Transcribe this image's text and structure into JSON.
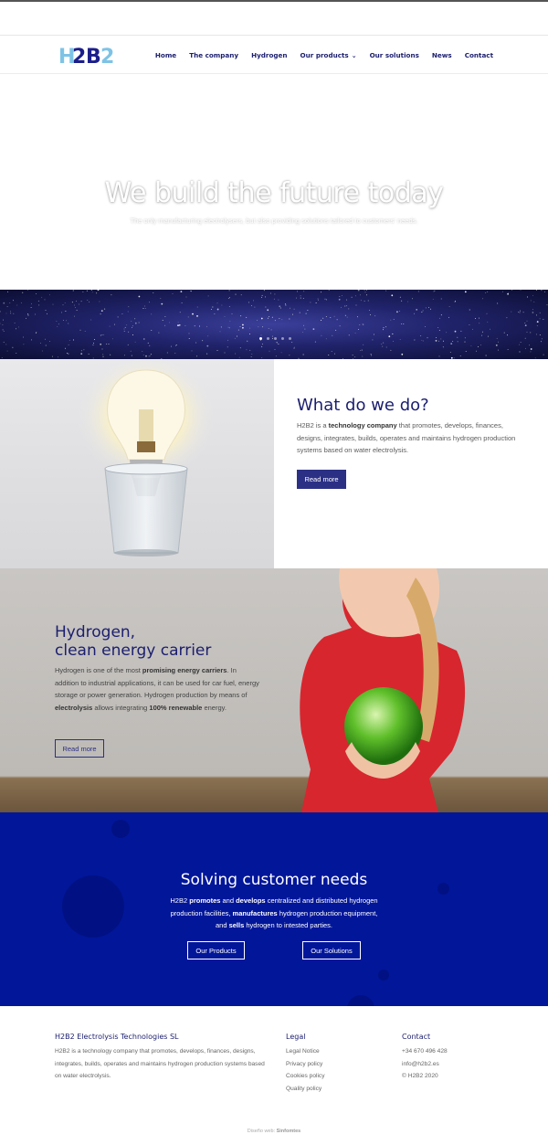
{
  "brand": {
    "logo_text": "H2B2"
  },
  "nav": {
    "items": [
      "Home",
      "The company",
      "Hydrogen",
      "Our products",
      "Our solutions",
      "News",
      "Contact"
    ]
  },
  "hero": {
    "title": "We build the future today",
    "subtitle": "The only manufacturing electrolysers, but also providing solutions tailored to customers' needs."
  },
  "slider": {
    "dot_count": 5,
    "active_index": 0
  },
  "what": {
    "title": "What do we do?",
    "text_1": "H2B2 is a ",
    "text_bold": "technology company",
    "text_2": " that promotes, develops, finances, designs, integrates, builds, operates and maintains hydrogen production systems based on water electrolysis.",
    "button": "Read more"
  },
  "hydrogen": {
    "title_line1": "Hydrogen,",
    "title_line2": "clean energy carrier",
    "t1": "Hydrogen is one of the most ",
    "b1": "promising energy carriers",
    "t2": ". In addition to industrial applications, it can be used for car fuel, energy storage or power generation. Hydrogen production by means of ",
    "b2": "electrolysis",
    "t3": " allows integrating ",
    "b3": "100% renewable",
    "t4": " energy.",
    "button": "Read more"
  },
  "solving": {
    "title": "Solving customer needs",
    "t1": "H2B2 ",
    "b1": "promotes",
    "t2": " and ",
    "b2": "develops",
    "t3": " centralized and distributed hydrogen production facilities, ",
    "b3": "manufactures",
    "t4": " hydrogen production equipment, and ",
    "b4": "sells",
    "t5": " hydrogen to intested parties.",
    "button_products": "Our Products",
    "button_solutions": "Our Solutions"
  },
  "footer": {
    "company_title": "H2B2 Electrolysis Technologies SL",
    "company_text": "H2B2 is a technology company that promotes, develops, finances, designs, integrates, builds, operates and maintains hydrogen production systems based on water electrolysis.",
    "legal_title": "Legal",
    "legal_items": [
      "Legal Notice",
      "Privacy policy",
      "Cookies policy",
      "Quality policy"
    ],
    "contact_title": "Contact",
    "contact_items": [
      "+34 670 496 428",
      "info@h2b2.es",
      "© H2B2 2020"
    ],
    "credits_prefix": "Diseño web: ",
    "credits_name": "Sinfomtes"
  },
  "colors": {
    "brand_navy": "#1b1e6e",
    "button_navy": "#2c3085",
    "blue_section": "#02169a",
    "logo_light": "#7ec3e6"
  }
}
